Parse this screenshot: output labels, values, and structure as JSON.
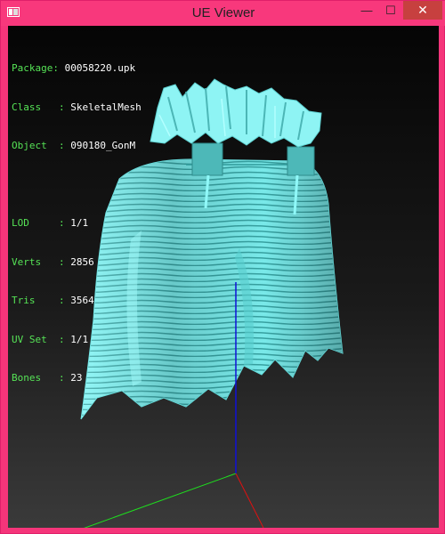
{
  "window": {
    "title": "UE Viewer",
    "controls": {
      "minimize": "—",
      "maximize": "☐",
      "close": "✕"
    }
  },
  "mesh_info": {
    "group1": [
      {
        "key": "Package: ",
        "value": "00058220.upk"
      },
      {
        "key": "Class   : ",
        "value": "SkeletalMesh"
      },
      {
        "key": "Object  : ",
        "value": "090180_GonM"
      }
    ],
    "group2": [
      {
        "key": "LOD     : ",
        "value": "1/1"
      },
      {
        "key": "Verts   : ",
        "value": "2856"
      },
      {
        "key": "Tris    : ",
        "value": "3564"
      },
      {
        "key": "UV Set  : ",
        "value": "1/1"
      },
      {
        "key": "Bones   : ",
        "value": "23"
      }
    ]
  },
  "colors": {
    "title_bar": "#f8387c",
    "info_keys": "#56e356",
    "info_values": "#ffffff",
    "mesh": "#7ff5f5",
    "axis_x": "#e01010",
    "axis_y": "#1ee01e",
    "axis_z": "#1010d8"
  }
}
